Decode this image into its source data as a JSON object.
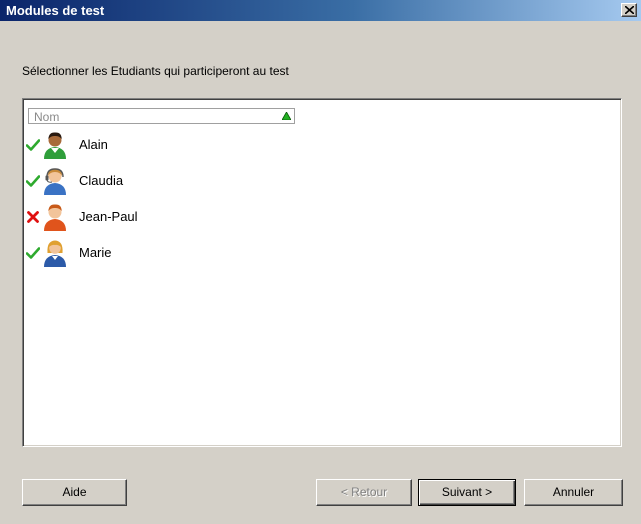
{
  "window": {
    "title": "Modules de test"
  },
  "instruction": "Sélectionner les Etudiants qui participeront au test",
  "list": {
    "column_header": "Nom",
    "items": [
      {
        "name": "Alain",
        "status": "selected",
        "status_icon": "check-icon",
        "avatar": "user-green-icon"
      },
      {
        "name": "Claudia",
        "status": "selected",
        "status_icon": "check-icon",
        "avatar": "user-headset-icon"
      },
      {
        "name": "Jean-Paul",
        "status": "excluded",
        "status_icon": "cross-icon",
        "avatar": "user-orange-icon"
      },
      {
        "name": "Marie",
        "status": "selected",
        "status_icon": "check-icon",
        "avatar": "user-blue-icon"
      }
    ]
  },
  "buttons": {
    "help": "Aide",
    "back": "< Retour",
    "next": "Suivant >",
    "cancel": "Annuler"
  },
  "colors": {
    "title_gradient_start": "#0a246a",
    "title_gradient_end": "#a6caf0",
    "face": "#d4d0c8",
    "check": "#2eaa2e",
    "cross": "#e01010"
  }
}
